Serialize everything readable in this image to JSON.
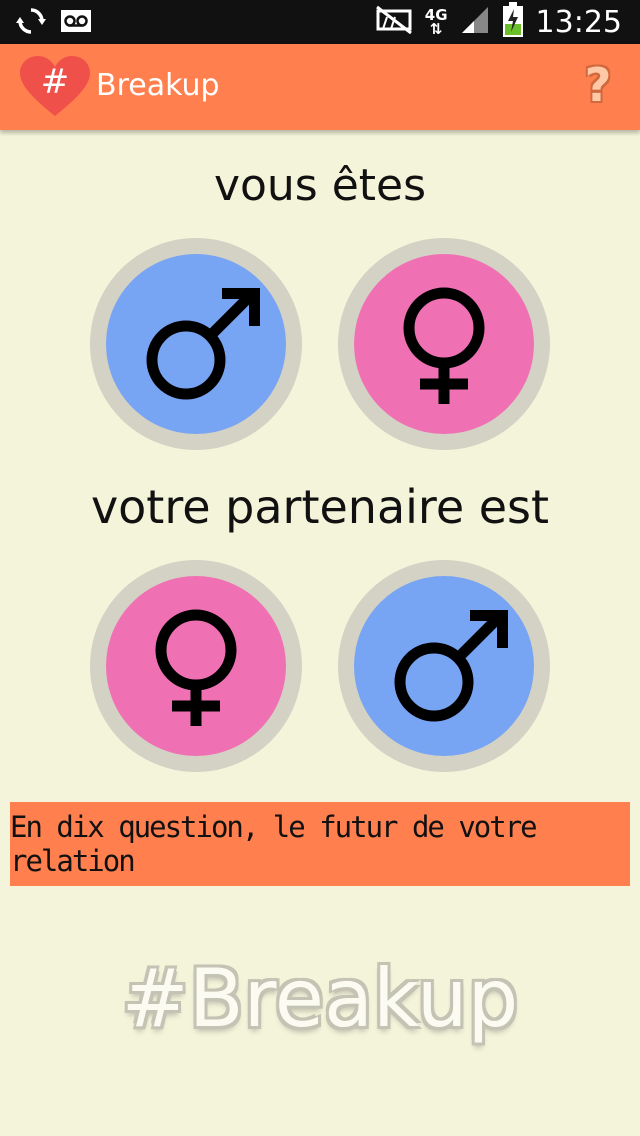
{
  "status_bar": {
    "time": "13:25",
    "network": "4G",
    "icons": [
      "sync-icon",
      "voicemail-icon",
      "no-signal-icon",
      "data-transfer-icon",
      "signal-icon",
      "battery-charging-icon"
    ]
  },
  "action_bar": {
    "title": "Breakup",
    "logo_symbol": "#",
    "help_label": "?"
  },
  "you_section": {
    "heading": "vous êtes",
    "options": [
      {
        "gender": "male",
        "icon": "male-symbol-icon",
        "color": "#77a4f3"
      },
      {
        "gender": "female",
        "icon": "female-symbol-icon",
        "color": "#f070b4"
      }
    ]
  },
  "partner_section": {
    "heading": "votre partenaire est",
    "options": [
      {
        "gender": "female",
        "icon": "female-symbol-icon",
        "color": "#f070b4"
      },
      {
        "gender": "male",
        "icon": "male-symbol-icon",
        "color": "#77a4f3"
      }
    ]
  },
  "cta": {
    "text": "En dix question, le futur de votre relation"
  },
  "brand": {
    "watermark": "#Breakup"
  },
  "colors": {
    "accent": "#ff7f4e",
    "background": "#f4f4da",
    "male": "#77a4f3",
    "female": "#f070b4",
    "ring": "#d4d2c4"
  }
}
